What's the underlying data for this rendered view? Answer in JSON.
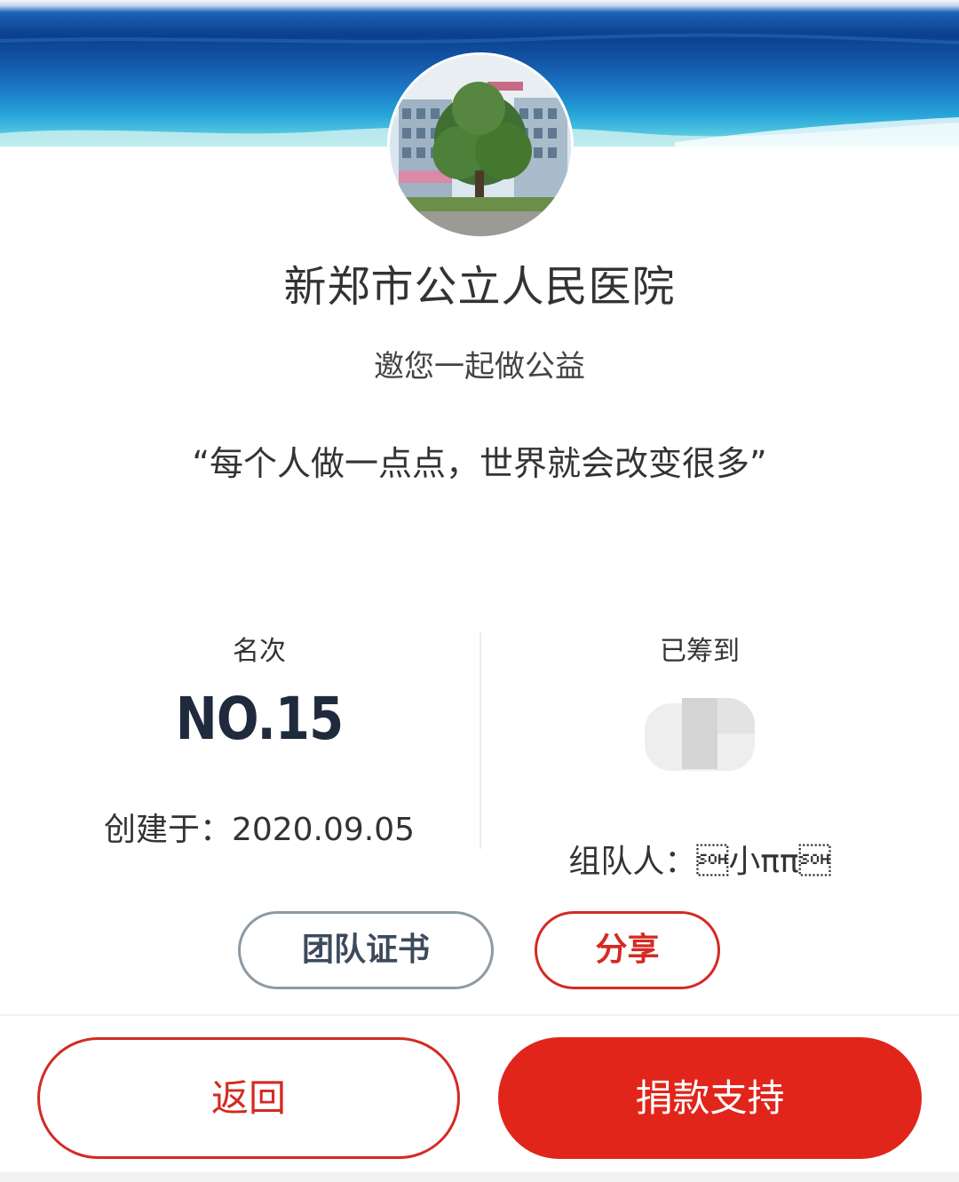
{
  "header": {
    "org_name": "新郑市公立人民医院",
    "invite_text": "邀您一起做公益",
    "slogan": "“每个人做一点点，世界就会改变很多”"
  },
  "stats": {
    "rank_label": "名次",
    "rank_value": "NO.15",
    "created_text": "创建于：2020.09.05",
    "raised_label": "已筹到",
    "organizer_text": "组队人：\u0001小ππ\u0001"
  },
  "actions": {
    "certificate_label": "团队证书",
    "share_label": "分享"
  },
  "footer": {
    "back_label": "返回",
    "donate_label": "捐款支持"
  },
  "colors": {
    "accent_red": "#e1251b",
    "text_dark": "#1f2a3d",
    "outline_gray": "#8c9aa4"
  }
}
